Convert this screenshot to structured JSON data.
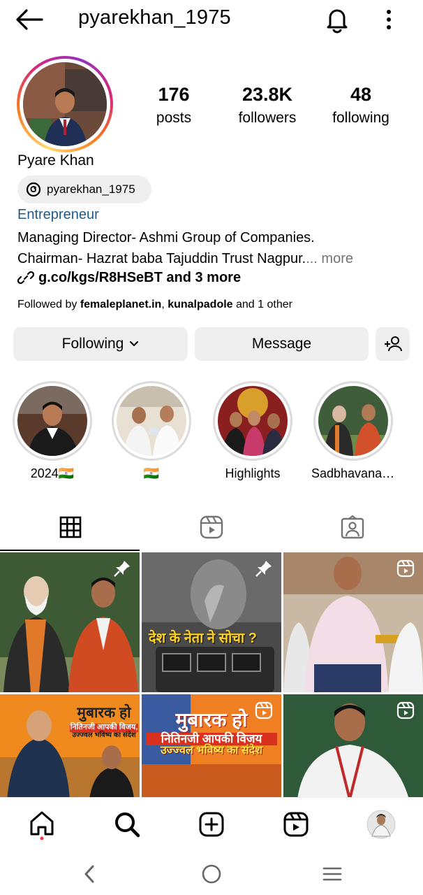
{
  "header": {
    "username": "pyarekhan_1975",
    "back_icon": "arrow-left-icon",
    "notifications_icon": "bell-icon",
    "menu_icon": "kebab-menu-icon"
  },
  "profile": {
    "stats": [
      {
        "value": "176",
        "label": "posts"
      },
      {
        "value": "23.8K",
        "label": "followers"
      },
      {
        "value": "48",
        "label": "following"
      }
    ],
    "name": "Pyare Khan",
    "threads_handle": "pyarekhan_1975",
    "category": "Entrepreneur",
    "bio_line1": "Managing Director- Ashmi Group of Companies.",
    "bio_line2": "Chairman- Hazrat baba Tajuddin Trust Nagpur.",
    "bio_more": "... more",
    "link_text": "g.co/kgs/R8HSeBT and 3 more",
    "followed_by_prefix": "Followed by ",
    "followed_by_1": "femaleplanet.in",
    "followed_by_sep": ", ",
    "followed_by_2": "kunalpadole",
    "followed_by_suffix": " and 1 other"
  },
  "actions": {
    "following_label": "Following",
    "message_label": "Message",
    "add_user_icon": "add-user-icon"
  },
  "highlights": [
    {
      "label": "2024🇮🇳"
    },
    {
      "label": "🇮🇳"
    },
    {
      "label": "Highlights"
    },
    {
      "label": "Sadbhavana20..."
    }
  ],
  "tabs": [
    {
      "icon": "grid-icon",
      "active": true
    },
    {
      "icon": "reels-icon",
      "active": false
    },
    {
      "icon": "tagged-icon",
      "active": false
    }
  ],
  "posts": [
    {
      "badge": "pin-icon",
      "overlay_text": ""
    },
    {
      "badge": "pin-icon",
      "overlay_text": "देश के नेता ने सोचा ?"
    },
    {
      "badge": "reel-icon",
      "overlay_text": ""
    },
    {
      "badge": "",
      "overlay_text": "मुबारक हो"
    },
    {
      "badge": "reel-icon",
      "overlay_text": "मुबारक हो"
    },
    {
      "badge": "reel-icon",
      "overlay_text": ""
    }
  ],
  "post_texts": {
    "p4_line2": "नितिनजी आपकी विजय,",
    "p4_line3": "उज्ज्वल भविष्य का संदेश",
    "p5_line2": "नितिनजी आपकी विजय",
    "p5_line3": "उज्ज्वल भविष्य का संदेश"
  },
  "bottom_nav": [
    "home-icon",
    "search-icon",
    "create-icon",
    "reels-icon",
    "profile-avatar"
  ],
  "system_nav": [
    "back-icon",
    "home-circle-icon",
    "recents-icon"
  ],
  "colors": {
    "category": "#1f5a8a",
    "button_bg": "#efefef",
    "muted": "#737373",
    "notification_dot": "#ff3040"
  }
}
